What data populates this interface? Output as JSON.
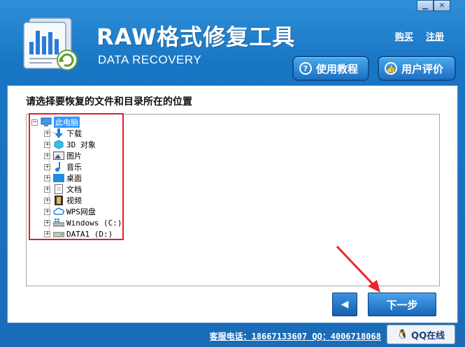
{
  "header": {
    "title": "RAW格式修复工具",
    "subtitle": "DATA RECOVERY",
    "buy_link": "购买",
    "register_link": "注册",
    "tutorial_button": "使用教程",
    "review_button": "用户评价",
    "minimize_glyph": "▁",
    "close_glyph": "✕"
  },
  "main": {
    "prompt": "请选择要恢复的文件和目录所在的位置",
    "tree": {
      "root": "此电脑",
      "items": [
        {
          "label": "下载",
          "icon": "download-arrow-icon"
        },
        {
          "label": "3D 对象",
          "icon": "cube-icon"
        },
        {
          "label": "图片",
          "icon": "picture-icon"
        },
        {
          "label": "音乐",
          "icon": "music-note-icon"
        },
        {
          "label": "桌面",
          "icon": "desktop-icon"
        },
        {
          "label": "文档",
          "icon": "document-icon"
        },
        {
          "label": "视频",
          "icon": "film-icon"
        },
        {
          "label": "WPS网盘",
          "icon": "cloud-icon"
        },
        {
          "label": "Windows (C:)",
          "icon": "windows-drive-icon"
        },
        {
          "label": "DATA1 (D:)",
          "icon": "drive-icon"
        }
      ]
    },
    "back_glyph": "◀",
    "next_button": "下一步"
  },
  "footer": {
    "contact": "客服电话：18667133607 QQ：4006718068",
    "qq_label": "QQ在线"
  },
  "colors": {
    "accent": "#1a6cb8",
    "highlight": "#e0202a",
    "selection": "#3399ff"
  }
}
